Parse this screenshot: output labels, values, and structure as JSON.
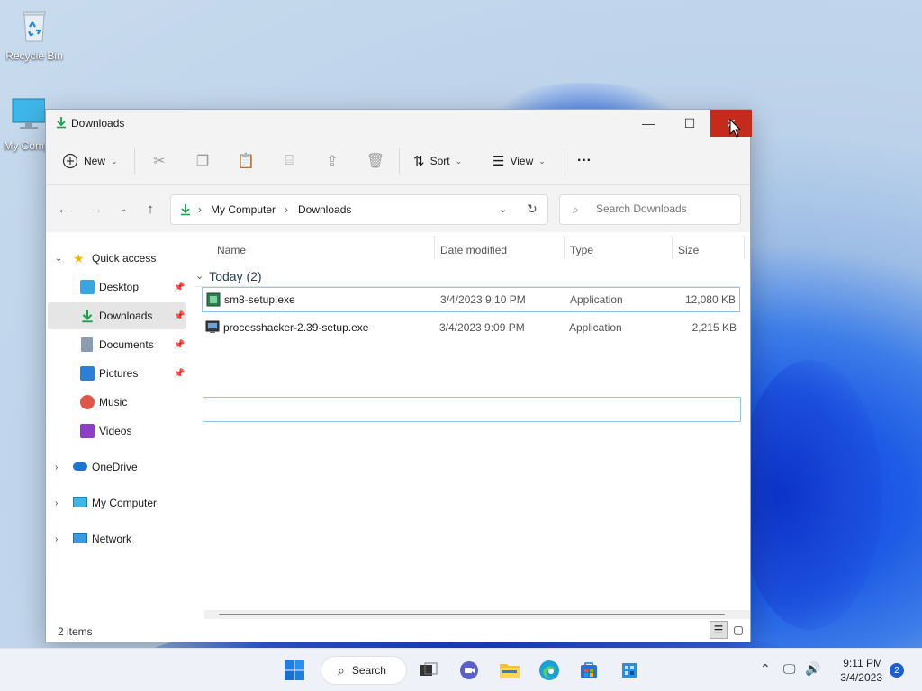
{
  "desktop": {
    "icons": [
      {
        "label": "Recycle Bin"
      },
      {
        "label": "My Comp"
      }
    ]
  },
  "window": {
    "title": "Downloads",
    "controls": {
      "minimize": "—",
      "maximize": "☐",
      "close": "✕"
    }
  },
  "toolbar": {
    "new_label": "New",
    "sort_label": "Sort",
    "view_label": "View",
    "more_label": "···"
  },
  "address": {
    "crumbs": [
      "My Computer",
      "Downloads"
    ],
    "search_placeholder": "Search Downloads"
  },
  "sidebar": {
    "items": [
      {
        "label": "Quick access"
      },
      {
        "label": "Desktop"
      },
      {
        "label": "Downloads"
      },
      {
        "label": "Documents"
      },
      {
        "label": "Pictures"
      },
      {
        "label": "Music"
      },
      {
        "label": "Videos"
      },
      {
        "label": "OneDrive"
      },
      {
        "label": "My Computer"
      },
      {
        "label": "Network"
      }
    ]
  },
  "columns": {
    "name": "Name",
    "date": "Date modified",
    "type": "Type",
    "size": "Size"
  },
  "group": {
    "label": "Today (2)"
  },
  "files": [
    {
      "name": "sm8-setup.exe",
      "date": "3/4/2023 9:10 PM",
      "type": "Application",
      "size": "12,080 KB"
    },
    {
      "name": "processhacker-2.39-setup.exe",
      "date": "3/4/2023 9:09 PM",
      "type": "Application",
      "size": "2,215 KB"
    }
  ],
  "status": {
    "items": "2 items"
  },
  "taskbar": {
    "search_label": "Search",
    "time": "9:11 PM",
    "date": "3/4/2023",
    "notification_count": "2"
  },
  "colors": {
    "accent": "#0067c0",
    "close_red": "#c42b1c",
    "download_green": "#1e9e50"
  }
}
